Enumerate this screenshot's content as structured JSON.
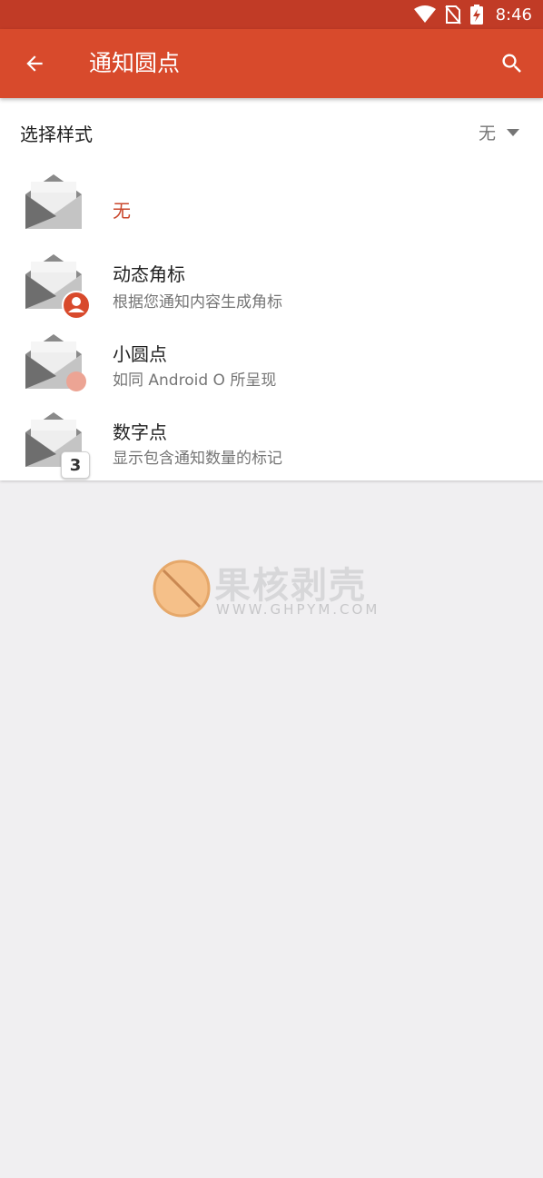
{
  "status_bar": {
    "time": "8:46",
    "icons": [
      "wifi-icon",
      "no-sim-icon",
      "battery-charging-icon"
    ],
    "color": "#c13b26"
  },
  "app_bar": {
    "title": "通知圆点",
    "back_icon": "arrow-back-icon",
    "search_icon": "search-icon",
    "color": "#d84a2c"
  },
  "style_selector": {
    "label": "选择样式",
    "value": "无"
  },
  "options": [
    {
      "title": "无",
      "subtitle": "",
      "selected": true,
      "badge": "none"
    },
    {
      "title": "动态角标",
      "subtitle": "根据您通知内容生成角标",
      "selected": false,
      "badge": "avatar"
    },
    {
      "title": "小圆点",
      "subtitle": "如同 Android O 所呈现",
      "selected": false,
      "badge": "dot"
    },
    {
      "title": "数字点",
      "subtitle": "显示包含通知数量的标记",
      "badge_text": "3",
      "selected": false,
      "badge": "count"
    }
  ],
  "watermark": {
    "text": "果核剥壳",
    "url": "WWW.GHPYM.COM"
  },
  "colors": {
    "accent": "#c9462b",
    "background": "#f0eff1",
    "dot_badge": "#eca494"
  }
}
